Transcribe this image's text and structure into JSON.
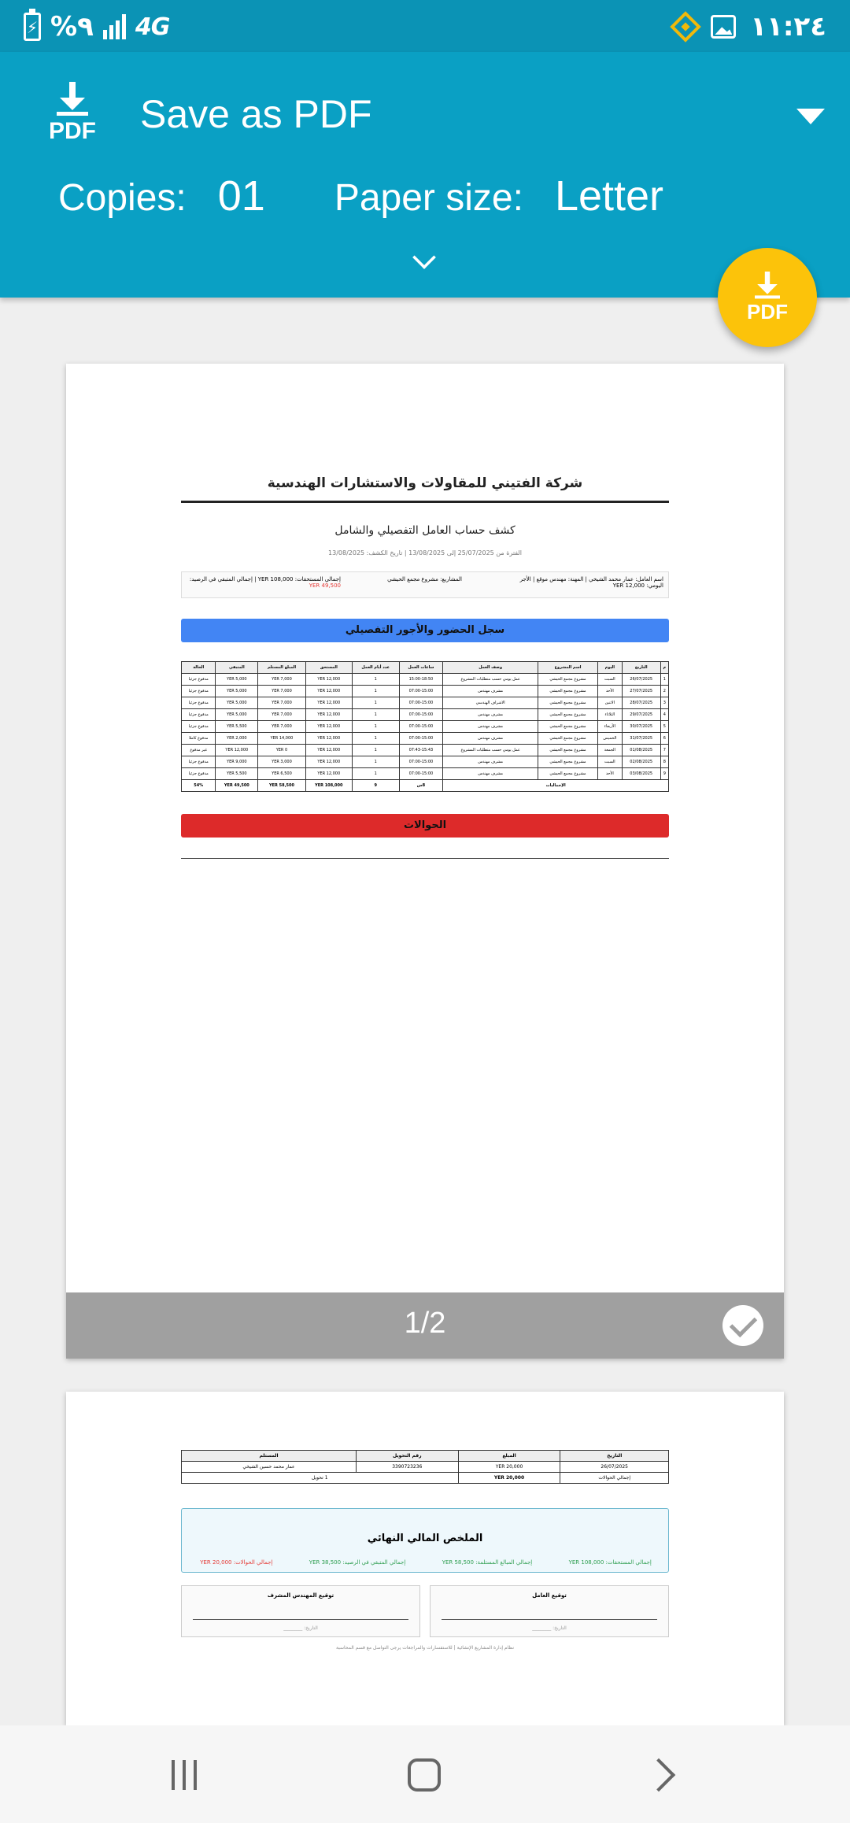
{
  "status_bar": {
    "battery_percent": "%٩",
    "network": "4G",
    "time": "١١:٢٤"
  },
  "toolbar": {
    "printer_icon_label": "PDF",
    "printer_name": "Save as PDF",
    "copies_label": "Copies:",
    "copies_value": "01",
    "paper_size_label": "Paper size:",
    "paper_size_value": "Letter"
  },
  "fab": {
    "label": "PDF"
  },
  "page1": {
    "company": "شركة الفتيني للمقاولات والاستشارات الهندسية",
    "subtitle": "كشف حساب العامل التفصيلي والشامل",
    "period": "الفترة من 25/07/2025 إلى 13/08/2025 | تاريخ الكشف: 13/08/2025",
    "worker_info": "اسم العامل: عمار محمد الشيخي | المهنة: مهندس موقع | الأجر اليومي: YER 12,000",
    "projects": "المشاريع: مشروع مجمع الحيشي",
    "totals": "إجمالي المستحقات: YER 108,000 | إجمالي المتبقي في الرصيد:",
    "balance": "YER 49,500",
    "attendance_title": "سجل الحضور والأجور التفصيلي",
    "table_headers": [
      "م",
      "التاريخ",
      "اليوم",
      "اسم المشروع",
      "وصف العمل",
      "ساعات العمل",
      "عدد أيام العمل",
      "المستحق",
      "المبلغ المستلم",
      "المتبقي",
      "الحالة"
    ],
    "table_rows": [
      [
        "1",
        "26/07/2025",
        "السبت",
        "مشروع مجمع الحيشي",
        "عمل يومي حسب متطلبات المشروع",
        "15:00-18:50",
        "1",
        "YER 12,000",
        "YER 7,000",
        "YER 5,000",
        "مدفوع جزئيا"
      ],
      [
        "2",
        "27/07/2025",
        "الأحد",
        "مشروع مجمع الحيشي",
        "مشرف مهندس",
        "07:00-15:00",
        "1",
        "YER 12,000",
        "YER 7,000",
        "YER 5,000",
        "مدفوع جزئيا"
      ],
      [
        "3",
        "28/07/2025",
        "الاثنين",
        "مشروع مجمع الحيشي",
        "الاشراف الهندسي",
        "07:00-15:00",
        "1",
        "YER 12,000",
        "YER 7,000",
        "YER 5,000",
        "مدفوع جزئيا"
      ],
      [
        "4",
        "29/07/2025",
        "الثلاثاء",
        "مشروع مجمع الحيشي",
        "مشرف مهندس",
        "07:00-15:00",
        "1",
        "YER 12,000",
        "YER 7,000",
        "YER 5,000",
        "مدفوع جزئيا"
      ],
      [
        "5",
        "30/07/2025",
        "الأربعاء",
        "مشروع مجمع الحيشي",
        "مشرف مهندس",
        "07:00-15:00",
        "1",
        "YER 12,000",
        "YER 7,000",
        "YER 5,500",
        "مدفوع جزئيا"
      ],
      [
        "6",
        "31/07/2025",
        "الخميس",
        "مشروع مجمع الحيشي",
        "مشرف مهندس",
        "07:00-15:00",
        "1",
        "YER 12,000",
        "YER 14,000",
        "YER 2,000",
        "مدفوع كاملا"
      ],
      [
        "7",
        "01/08/2025",
        "الجمعة",
        "مشروع مجمع الحيشي",
        "عمل يومي حسب متطلبات المشروع",
        "07:43-15:43",
        "1",
        "YER 12,000",
        "YER 0",
        "YER 12,000",
        "غير مدفوع"
      ],
      [
        "8",
        "02/08/2025",
        "السبت",
        "مشروع مجمع الحيشي",
        "مشرف مهندس",
        "07:00-15:00",
        "1",
        "YER 12,000",
        "YER 3,000",
        "YER 9,000",
        "مدفوع جزئيا"
      ],
      [
        "9",
        "03/08/2025",
        "الأحد",
        "مشروع مجمع الحيشي",
        "مشرف مهندس",
        "07:00-15:00",
        "1",
        "YER 12,000",
        "YER 6,500",
        "YER 5,500",
        "مدفوع جزئيا"
      ]
    ],
    "table_total": [
      "الإجماليات",
      "8س",
      "9",
      "YER 108,000",
      "YER 58,500",
      "YER 49,500",
      "54%"
    ],
    "transfers_title": "الحوالات",
    "page_indicator": "1/2"
  },
  "page2": {
    "transfer_headers": [
      "التاريخ",
      "المبلغ",
      "رقم التحويل",
      "المستلم"
    ],
    "transfer_row": [
      "26/07/2025",
      "YER 20,000",
      "3390723236",
      "عمار محمد حسين الشيخي"
    ],
    "transfer_total_label": "إجمالي الحوالات",
    "transfer_total_value": "YER 20,000",
    "transfer_count": "1 تحويل",
    "summary_title": "الملخص المالي النهائي",
    "summary_due": "إجمالي المستحقات: YER 108,000",
    "summary_received": "إجمالي المبالغ المستلمة: YER 58,500",
    "summary_balance": "إجمالي المتبقي في الرصيد: YER 38,500",
    "summary_transfers": "إجمالي الحوالات: YER 20,000",
    "sig_worker": "توقيع العامل",
    "sig_engineer": "توقيع المهندس المشرف",
    "sig_date": "التاريخ: ________",
    "footer_note": "نظام إدارة المشاريع الإنشائية | للاستفسارات والمراجعات يرجى التواصل مع قسم المحاسبة"
  }
}
